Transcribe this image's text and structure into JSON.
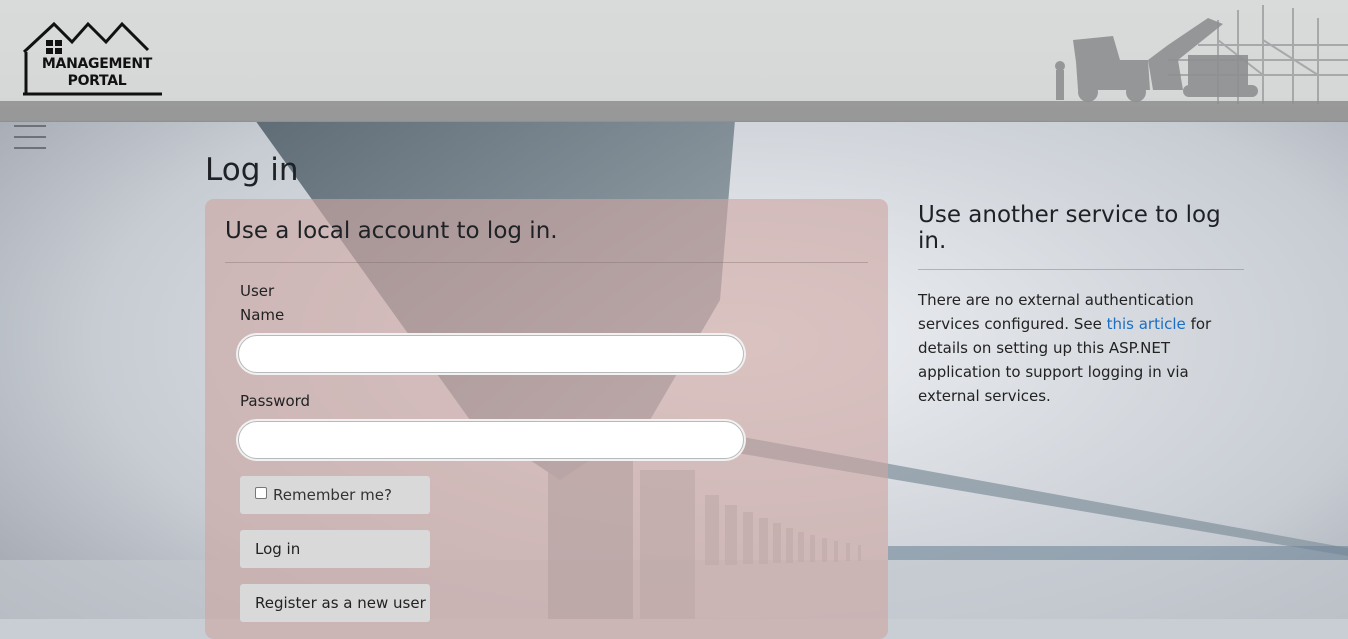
{
  "header": {
    "logo_line1": "MANAGEMENT",
    "logo_line2": "PORTAL"
  },
  "page": {
    "title": "Log in"
  },
  "local": {
    "heading": "Use a local account to log in.",
    "username_label_line1": "User",
    "username_label_line2": "Name",
    "username_value": "",
    "password_label": "Password",
    "password_value": "",
    "remember_label": "Remember me?",
    "remember_checked": false,
    "login_button": "Log in",
    "register_button": "Register as a new user"
  },
  "external": {
    "heading": "Use another service to log in.",
    "text_before_link": "There are no external authentication services configured. See ",
    "link_text": "this article",
    "text_after_link": " for details on setting up this ASP.NET application to support logging in via external services."
  },
  "colors": {
    "link": "#1b6ec2",
    "panel": "#cda7a2",
    "header": "#d9dbdb"
  }
}
